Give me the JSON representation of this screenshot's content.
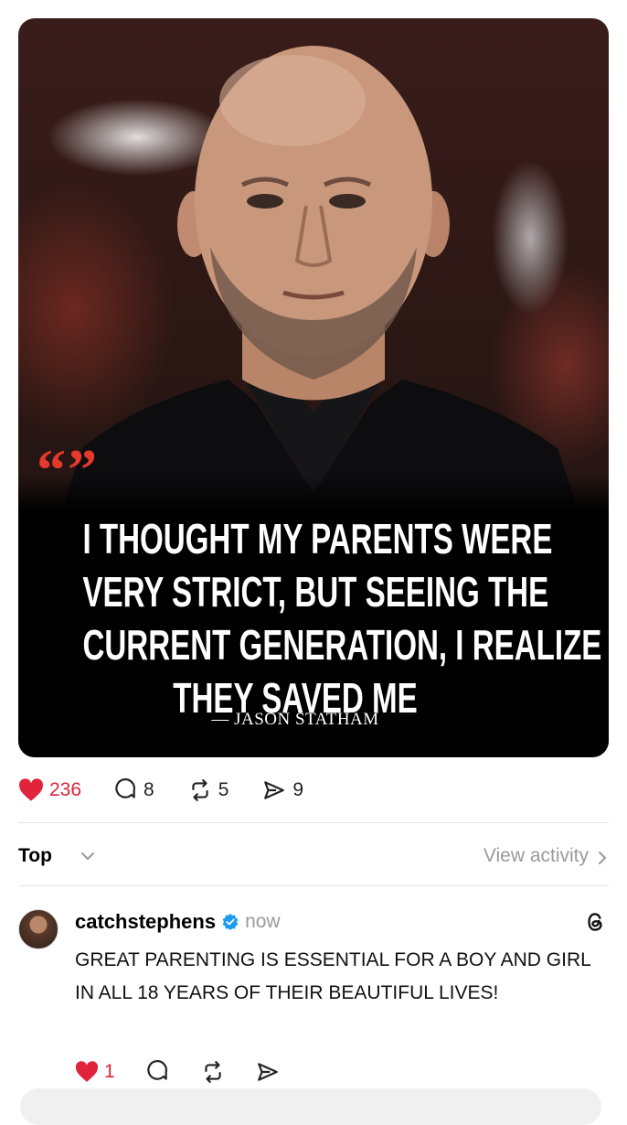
{
  "post": {
    "quote_mark": "“”",
    "quote_lines": [
      "I THOUGHT MY PARENTS WERE",
      "VERY STRICT, BUT SEEING THE",
      "CURRENT GENERATION, I REALIZE",
      "THEY SAVED ME"
    ],
    "quote_author": "— JASON STATHAM",
    "accent_color": "#e5392b",
    "actions": {
      "likes": "236",
      "comments": "8",
      "reposts": "5",
      "shares": "9"
    }
  },
  "sort": {
    "label": "Top",
    "view_activity": "View activity"
  },
  "reply": {
    "username": "catchstephens",
    "timestamp": "now",
    "text": "GREAT PARENTING IS ESSENTIAL FOR A BOY AND GIRL IN ALL 18 YEARS OF THEIR BEAUTIFUL LIVES!",
    "likes": "1"
  },
  "icons": [
    "heart-icon",
    "comment-icon",
    "repost-icon",
    "share-icon",
    "chevron-down-icon",
    "chevron-right-icon",
    "verified-icon",
    "threads-icon"
  ]
}
